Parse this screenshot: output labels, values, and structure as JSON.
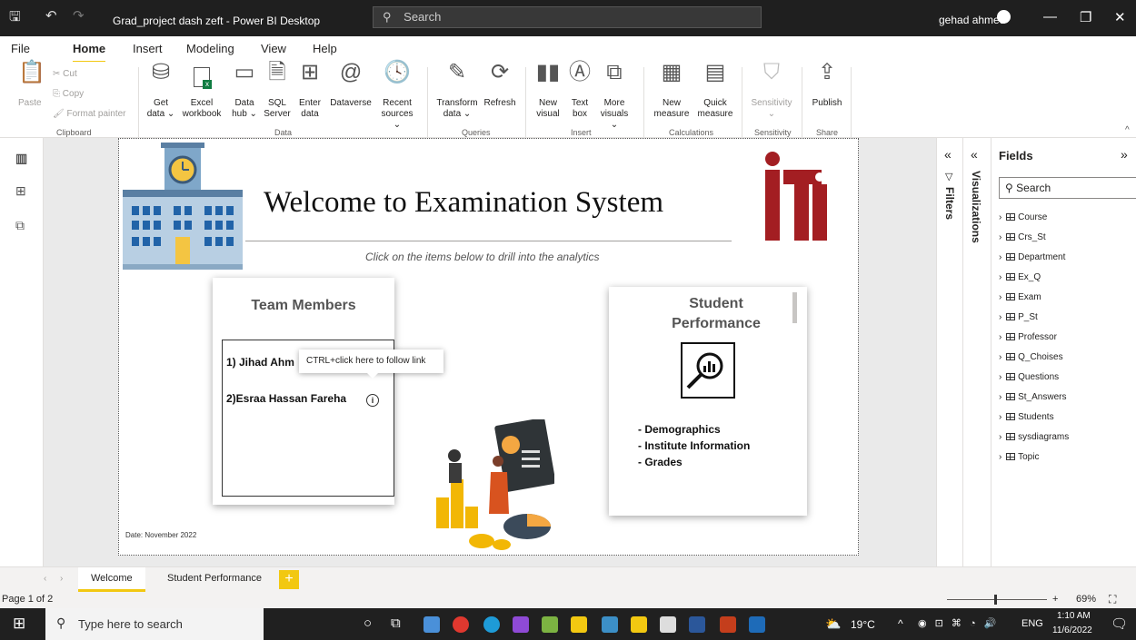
{
  "titlebar": {
    "title": "Grad_project dash zeft - Power BI Desktop",
    "search_placeholder": "Search",
    "user": "gehad ahmed"
  },
  "menu": [
    "File",
    "Home",
    "Insert",
    "Modeling",
    "View",
    "Help"
  ],
  "ribbon": {
    "clipboard": {
      "paste": "Paste",
      "cut": "Cut",
      "copy": "Copy",
      "format_painter": "Format painter",
      "label": "Clipboard"
    },
    "data": {
      "get_data": [
        "Get",
        "data ⌄"
      ],
      "excel": [
        "Excel",
        "workbook"
      ],
      "data_hub": [
        "Data",
        "hub ⌄"
      ],
      "sql": [
        "SQL",
        "Server"
      ],
      "enter": [
        "Enter",
        "data"
      ],
      "dataverse": [
        "Dataverse",
        ""
      ],
      "recent": [
        "Recent",
        "sources ⌄"
      ],
      "label": "Data"
    },
    "queries": {
      "transform": [
        "Transform",
        "data ⌄"
      ],
      "refresh": [
        "Refresh",
        ""
      ],
      "label": "Queries"
    },
    "insert": {
      "new_visual": [
        "New",
        "visual"
      ],
      "text_box": [
        "Text",
        "box"
      ],
      "more": [
        "More",
        "visuals ⌄"
      ],
      "label": "Insert"
    },
    "calculations": {
      "new_measure": [
        "New",
        "measure"
      ],
      "quick_measure": [
        "Quick",
        "measure"
      ],
      "label": "Calculations"
    },
    "sensitivity": {
      "btn": [
        "Sensitivity",
        "⌄"
      ],
      "label": "Sensitivity"
    },
    "share": {
      "publish": [
        "Publish",
        ""
      ],
      "label": "Share"
    }
  },
  "report": {
    "title": "Welcome to Examination System",
    "subtitle": "Click on the items below to drill into the analytics",
    "team_title": "Team Members",
    "member1": "1) Jihad Ahm",
    "member2": "2)Esraa Hassan Fareha",
    "tooltip": "CTRL+click here to follow link",
    "sp_title_1": "Student",
    "sp_title_2": "Performance",
    "sp_items": [
      "- Demographics",
      "- Institute Information",
      "- Grades"
    ],
    "date": "Date: November 2022"
  },
  "panes": {
    "filters": "Filters",
    "visualizations": "Visualizations",
    "fields_title": "Fields",
    "fields_search": "Search",
    "fields": [
      "Course",
      "Crs_St",
      "Department",
      "Ex_Q",
      "Exam",
      "P_St",
      "Professor",
      "Q_Choises",
      "Questions",
      "St_Answers",
      "Students",
      "sysdiagrams",
      "Topic"
    ]
  },
  "tabs": [
    "Welcome",
    "Student Performance"
  ],
  "status": {
    "page": "Page 1 of 2",
    "zoom": "69%"
  },
  "taskbar": {
    "search": "Type here to search",
    "temp": "19°C",
    "lang": "ENG",
    "time": "1:10 AM",
    "date": "11/6/2022"
  }
}
